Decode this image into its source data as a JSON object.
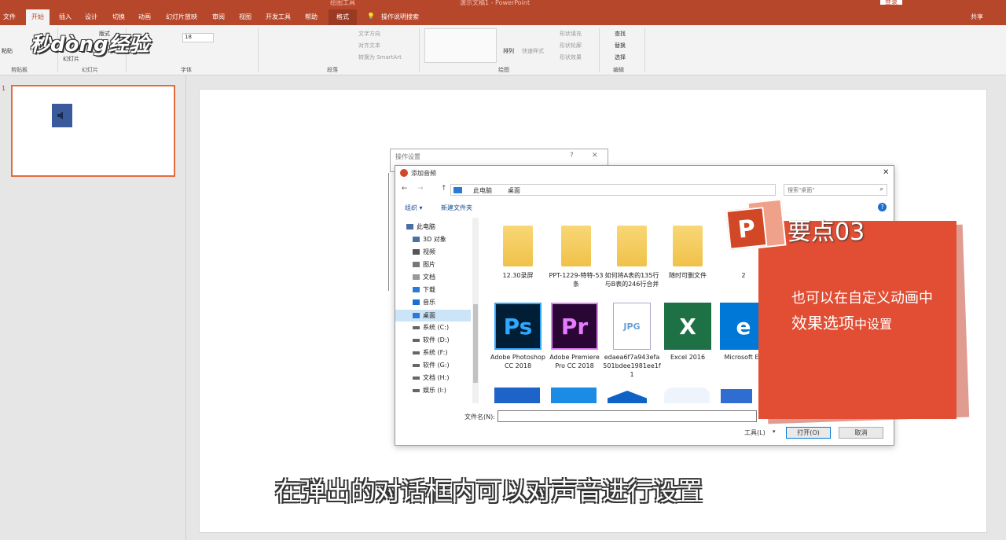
{
  "window": {
    "title": "演示文稿1 - PowerPoint",
    "context_tool": "绘图工具",
    "login": "登录",
    "share": "共享"
  },
  "tabs": {
    "file": "文件",
    "home": "开始",
    "insert": "插入",
    "design": "设计",
    "transitions": "切换",
    "animations": "动画",
    "slideshow": "幻灯片放映",
    "review": "审阅",
    "view": "视图",
    "developer": "开发工具",
    "help": "帮助",
    "format": "格式",
    "tellme": "操作说明搜索"
  },
  "ribbon": {
    "groups": {
      "clipboard": "剪贴板",
      "slides": "幻灯片",
      "font": "字体",
      "paragraph": "段落",
      "drawing": "绘图",
      "editing": "编辑"
    },
    "paste": "粘贴",
    "new_slide": "幻灯片",
    "layout": "版式",
    "font_size": "18",
    "text_direction": "文字方向",
    "align_text": "对齐文本",
    "smartart": "转换为 SmartArt",
    "arrange": "排列",
    "quick_styles": "快速样式",
    "shape_fill": "形状填充",
    "shape_outline": "形状轮廓",
    "shape_effects": "形状效果",
    "find": "查找",
    "replace": "替换",
    "select": "选择"
  },
  "watermark": "秒dòng经验",
  "thumbnail": {
    "number": "1"
  },
  "dialogs": {
    "action": {
      "title": "操作设置",
      "help": "?",
      "close": "✕"
    },
    "file": {
      "title": "添加音频",
      "close": "✕",
      "breadcrumb": [
        "此电脑",
        "桌面"
      ],
      "search_placeholder": "搜索\"桌面\"",
      "organize": "组织 ▾",
      "new_folder": "新建文件夹",
      "nav": [
        "此电脑",
        "3D 对象",
        "视频",
        "图片",
        "文档",
        "下载",
        "音乐",
        "桌面",
        "系统 (C:)",
        "软件 (D:)",
        "系统 (F:)",
        "软件 (G:)",
        "文档 (H:)",
        "娱乐 (I:)"
      ],
      "folders": [
        "12.30录屏",
        "PPT-1229-特特-53条",
        "如何将A表的135行与B表的246行合并",
        "随时可删文件",
        "2"
      ],
      "apps": [
        {
          "label": "Adobe Photoshop CC 2018",
          "glyph": "Ps",
          "bg": "#001e36",
          "fg": "#31a8ff"
        },
        {
          "label": "Adobe Premiere Pro CC 2018",
          "glyph": "Pr",
          "bg": "#2a0634",
          "fg": "#e77cff"
        },
        {
          "label": "edaea6f7a943efa501bdee1981ee1f1",
          "glyph": "JPG",
          "bg": "#ffffff",
          "fg": "#6a9fd4"
        },
        {
          "label": "Excel 2016",
          "glyph": "X",
          "bg": "#1e7145",
          "fg": "#ffffff"
        },
        {
          "label": "Microsoft Ed",
          "glyph": "e",
          "bg": "#0078d7",
          "fg": "#ffffff"
        }
      ],
      "filename_label": "文件名(N):",
      "filename_value": "",
      "tools": "工具(L)",
      "open": "打开(O)",
      "cancel": "取消"
    }
  },
  "callout": {
    "brand": "P",
    "title": "要点03",
    "body_line1": "也可以在自定义动画中",
    "body_line2_big": "效果选项",
    "body_line2_small": "中设置"
  },
  "caption": "在弹出的对话框内可以对声音进行设置"
}
